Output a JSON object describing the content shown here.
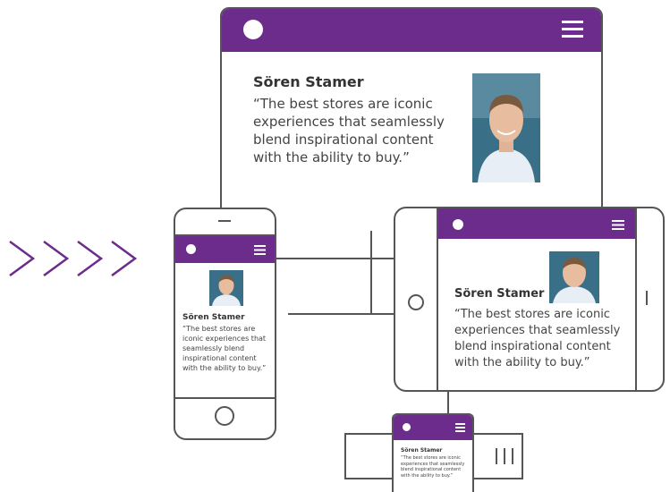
{
  "person_name": "Sören Stamer",
  "quote": "“The best stores are iconic experiences that seamlessly blend inspirational content with the ability to buy.”",
  "colors": {
    "accent": "#6b2c8c",
    "outline": "#555555",
    "text": "#444444"
  },
  "icons": [
    "chevron-right-icon",
    "circle-logo-icon",
    "hamburger-menu-icon",
    "home-button-icon"
  ]
}
